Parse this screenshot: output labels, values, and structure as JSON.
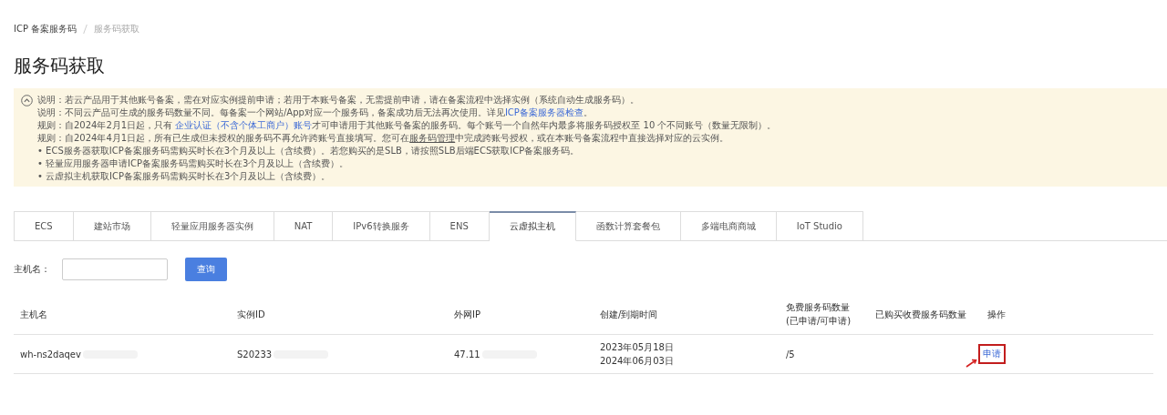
{
  "breadcrumb": [
    {
      "label": "ICP 备案服务码",
      "current": false
    },
    {
      "label": "服务码获取",
      "current": true
    }
  ],
  "title": "服务码获取",
  "notice": {
    "expanded": true,
    "lines": [
      [
        {
          "text": "说明：若云产品用于其他账号备案，需在对应实例提前申请；若用于本账号备案，无需提前申请，请在备案流程中选择实例（系统自动生成服务码）。",
          "kind": "text"
        }
      ],
      [
        {
          "text": "说明：不同云产品可生成的服务码数量不同。每备案一个网站/App对应一个服务码，备案成功后无法再次使用。详见",
          "kind": "text"
        },
        {
          "text": "ICP备案服务器检查",
          "kind": "link"
        },
        {
          "text": "。",
          "kind": "text"
        }
      ],
      [
        {
          "text": "规则：自2024年2月1日起，只有 ",
          "kind": "text"
        },
        {
          "text": "企业认证（不含个体工商户）账号",
          "kind": "link"
        },
        {
          "text": "才可申请用于其他账号备案的服务码。每个账号一个自然年内最多将服务码授权至 10 个不同账号（数量无限制）。",
          "kind": "text"
        }
      ],
      [
        {
          "text": "规则：自2024年4月1日起，所有已生成但未授权的服务码不再允许跨账号直接填写。您可在",
          "kind": "text"
        },
        {
          "text": "服务码管理",
          "kind": "underline"
        },
        {
          "text": "中完成跨账号授权，或在本账号备案流程中直接选择对应的云实例。",
          "kind": "text"
        }
      ],
      [
        {
          "text": "• ECS服务器获取ICP备案服务码需购买时长在3个月及以上（含续费）。若您购买的是SLB，请按照SLB后端ECS获取ICP备案服务码。",
          "kind": "text"
        }
      ],
      [
        {
          "text": "• 轻量应用服务器申请ICP备案服务码需购买时长在3个月及以上（含续费）。",
          "kind": "text"
        }
      ],
      [
        {
          "text": "• 云虚拟主机获取ICP备案服务码需购买时长在3个月及以上（含续费）。",
          "kind": "text"
        }
      ]
    ]
  },
  "tabs": [
    {
      "label": "ECS",
      "selected": false
    },
    {
      "label": "建站市场",
      "selected": false
    },
    {
      "label": "轻量应用服务器实例",
      "selected": false
    },
    {
      "label": "NAT",
      "selected": false
    },
    {
      "label": "IPv6转换服务",
      "selected": false
    },
    {
      "label": "ENS",
      "selected": false
    },
    {
      "label": "云虚拟主机",
      "selected": true
    },
    {
      "label": "函数计算套餐包",
      "selected": false
    },
    {
      "label": "多端电商商城",
      "selected": false
    },
    {
      "label": "IoT Studio",
      "selected": false
    }
  ],
  "search": {
    "label": "主机名：",
    "button": "查询"
  },
  "table": {
    "columns": [
      [
        "主机名"
      ],
      [
        "实例ID"
      ],
      [
        "外网IP"
      ],
      [
        "创建/到期时间"
      ],
      [
        "免费服务码数量",
        "(已申请/可申请)"
      ],
      [
        "已购买收费服务码数量"
      ],
      [
        "操作"
      ]
    ],
    "rows": [
      {
        "host": "wh-ns2daqev",
        "id": "S20233",
        "ip": "47.11",
        "dates": [
          "2023年05月18日",
          "2024年06月03日"
        ],
        "free": "/5",
        "paid": "",
        "action": "申请",
        "highlighted": true
      }
    ]
  }
}
